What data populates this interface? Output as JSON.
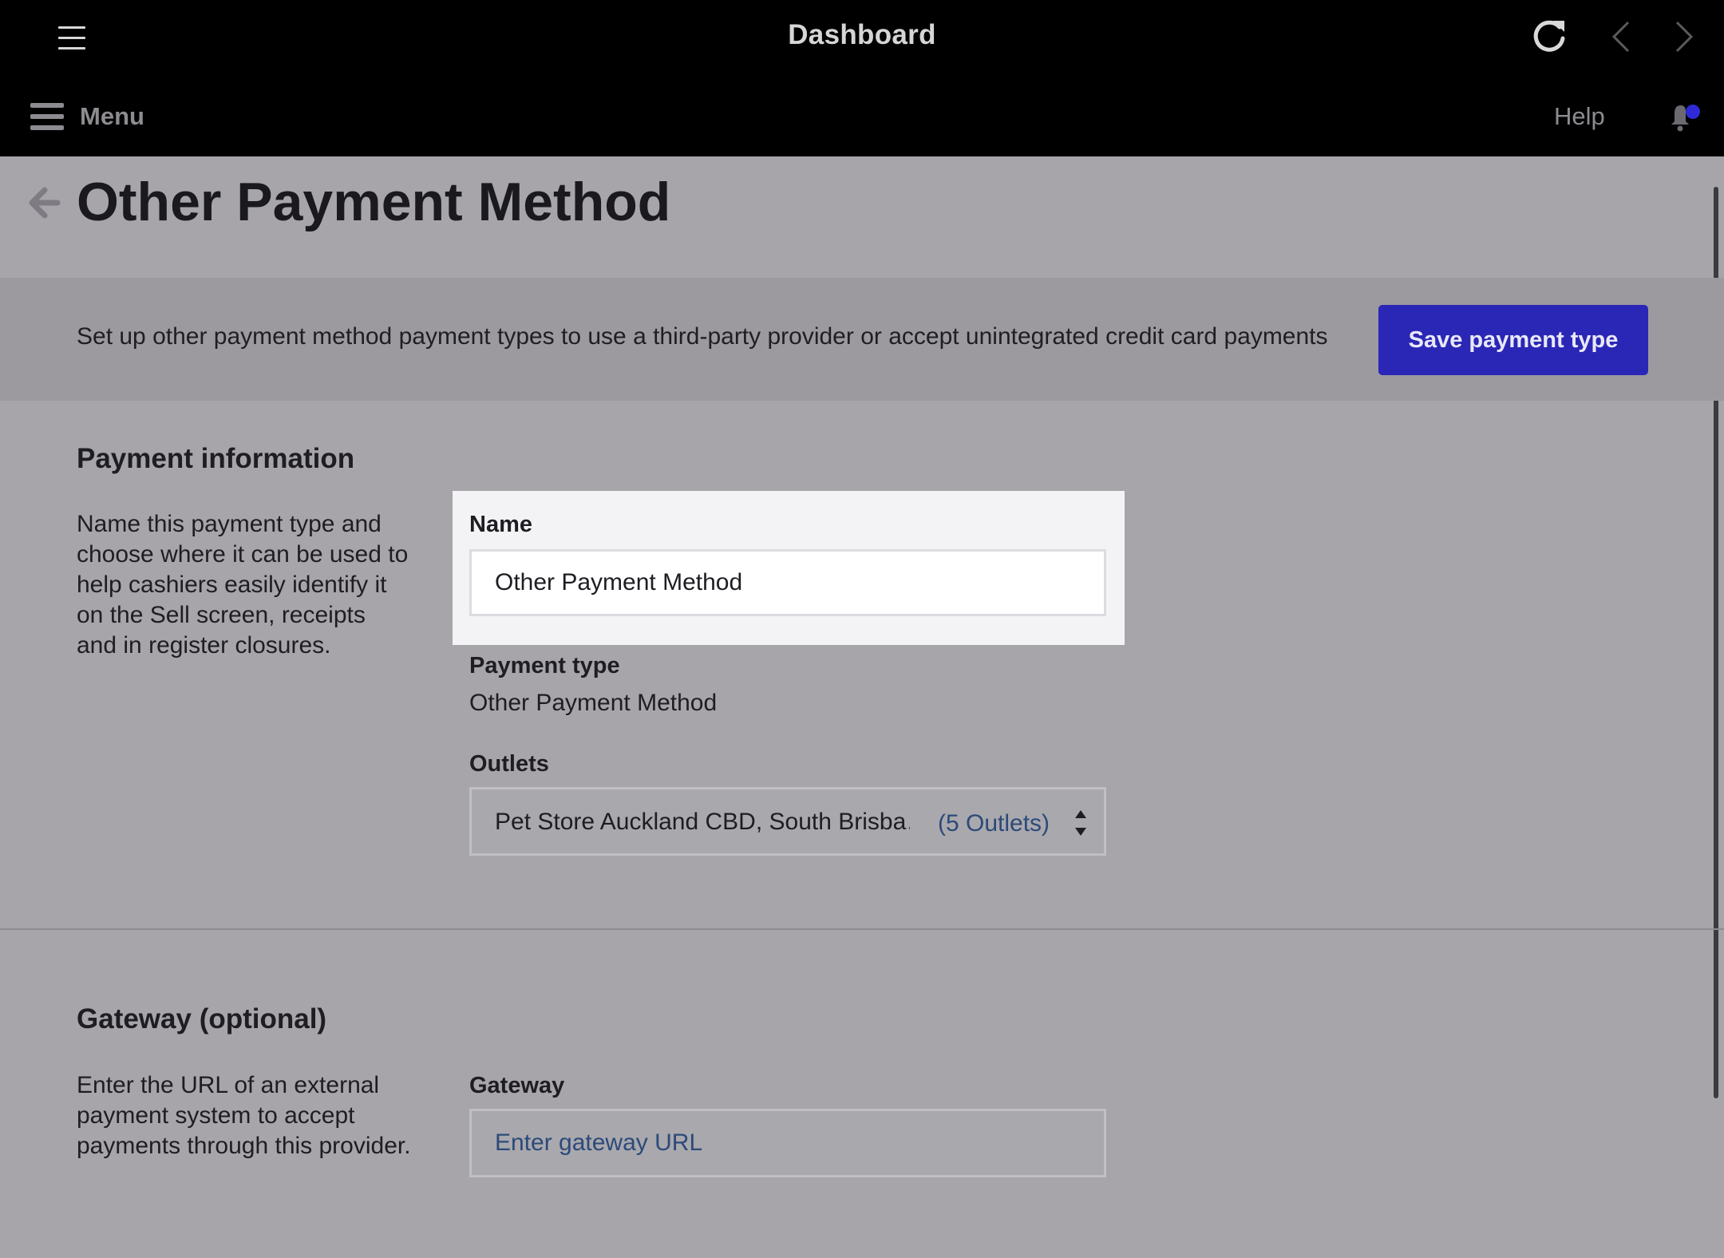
{
  "app": {
    "title": "Dashboard"
  },
  "nav": {
    "menu_label": "Menu",
    "help_label": "Help"
  },
  "page": {
    "title": "Other Payment Method"
  },
  "banner": {
    "text": "Set up other payment method payment types to use a third-party provider or accept unintegrated credit card payments",
    "save_label": "Save payment type",
    "save_color": "#2a27b7"
  },
  "payment_info": {
    "title": "Payment information",
    "description": "Name this payment type and choose where it can be used to help cashiers easily identify it on the Sell screen, receipts and in register closures.",
    "name_label": "Name",
    "name_value": "Other Payment Method",
    "payment_type_label": "Payment type",
    "payment_type_value": "Other Payment Method",
    "outlets_label": "Outlets",
    "outlets_value": "Pet Store Auckland CBD, South Brisba…",
    "outlets_count": "(5 Outlets)"
  },
  "gateway": {
    "title": "Gateway (optional)",
    "description": "Enter the URL of an external payment system to accept payments through this provider.",
    "label": "Gateway",
    "placeholder": "Enter gateway URL"
  },
  "icons": {
    "hamburger": "hamburger-icon",
    "reload": "reload-icon",
    "back": "chevron-left-icon",
    "forward": "chevron-right-icon",
    "bell": "bell-icon",
    "back_link": "arrow-left-icon",
    "select_arrows": "updown-icon"
  },
  "notification_dot_color": "#2f2ad6"
}
